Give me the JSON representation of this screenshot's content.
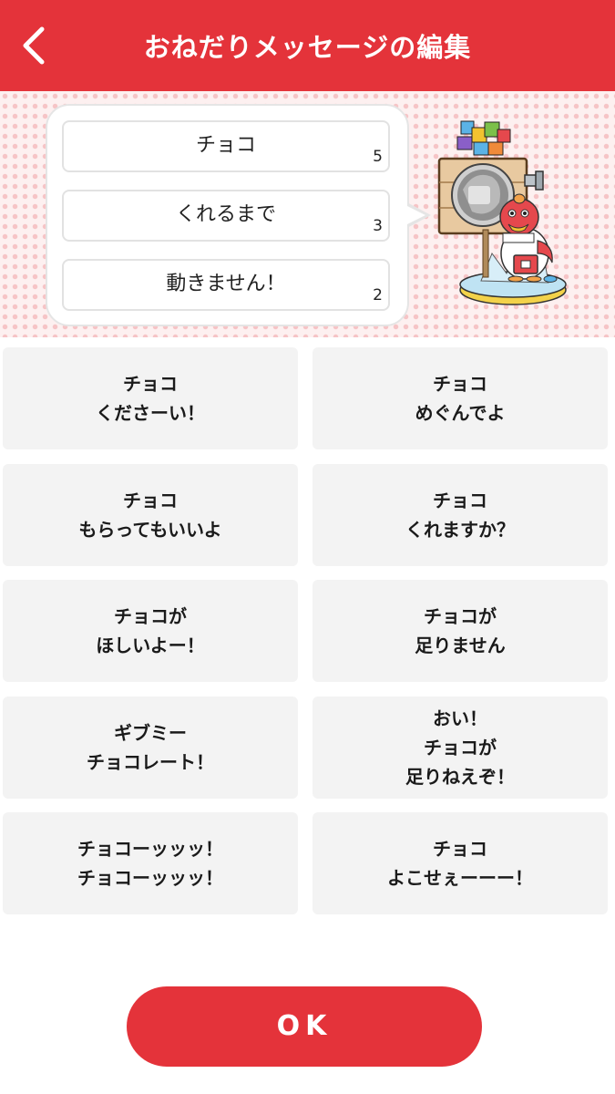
{
  "header": {
    "title": "おねだりメッセージの編集"
  },
  "preview": {
    "lines": [
      {
        "text": "チョコ",
        "count": "5"
      },
      {
        "text": "くれるまで",
        "count": "3"
      },
      {
        "text": "動きません！",
        "count": "2"
      }
    ]
  },
  "options": [
    "チョコ\nくださーい！",
    "チョコ\nめぐんでよ",
    "チョコ\nもらってもいいよ",
    "チョコ\nくれますか？",
    "チョコが\nほしいよー！",
    "チョコが\n足りません",
    "ギブミー\nチョコレート！",
    "おい！\nチョコが\n足りねえぞ！",
    "チョコーッッッ！\nチョコーッッッ！",
    "チョコ\nよこせぇーーー！"
  ],
  "footer": {
    "ok_label": "OK"
  },
  "colors": {
    "brand_red": "#e4333a",
    "option_bg": "#f3f3f3",
    "pattern_dot": "#f6c4c6"
  },
  "icons": {
    "back": "chevron-left-icon",
    "mascot": "mascot-character-illustration"
  }
}
